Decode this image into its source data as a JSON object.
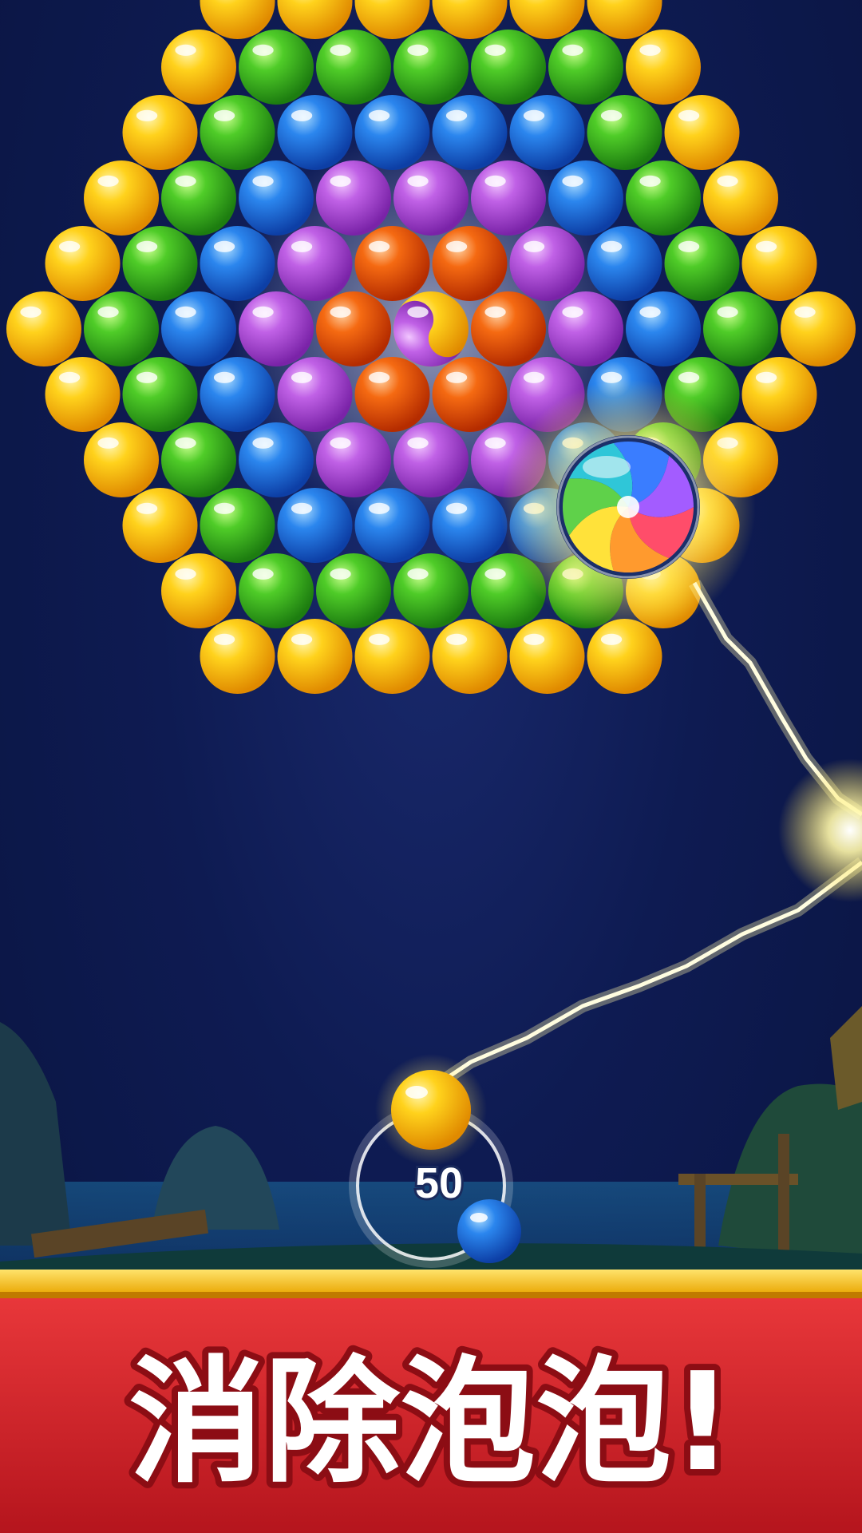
{
  "banner": {
    "text": "消除泡泡!"
  },
  "shooter": {
    "shots_left": "50",
    "current_ball_color": "yellow",
    "next_ball_color": "blue"
  },
  "special_bubble": {
    "type": "rainbow-swirl-bubble"
  },
  "center_bubble": {
    "type": "yin-yang-bubble",
    "colors": [
      "purple",
      "yellow"
    ]
  },
  "colors": {
    "yellow": "#f2b705",
    "green": "#35b31f",
    "blue": "#1f6ee0",
    "purple": "#b04dd6",
    "orange": "#f05a0a",
    "background": "#0e1b52",
    "banner_red": "#d8232a",
    "banner_gold": "#f7c21a"
  },
  "board": {
    "rows": [
      [
        "yellow",
        "yellow",
        "yellow",
        "yellow",
        "yellow",
        "yellow"
      ],
      [
        "yellow",
        "green",
        "green",
        "green",
        "green",
        "green",
        "yellow"
      ],
      [
        "yellow",
        "green",
        "blue",
        "blue",
        "blue",
        "blue",
        "green",
        "yellow"
      ],
      [
        "yellow",
        "green",
        "blue",
        "purple",
        "purple",
        "purple",
        "blue",
        "green",
        "yellow"
      ],
      [
        "yellow",
        "green",
        "blue",
        "purple",
        "orange",
        "orange",
        "purple",
        "blue",
        "green",
        "yellow"
      ],
      [
        "yellow",
        "green",
        "blue",
        "purple",
        "orange",
        "yinyang",
        "orange",
        "purple",
        "blue",
        "green",
        "yellow"
      ],
      [
        "yellow",
        "green",
        "blue",
        "purple",
        "orange",
        "orange",
        "purple",
        "blue",
        "green",
        "yellow"
      ],
      [
        "yellow",
        "green",
        "blue",
        "purple",
        "purple",
        "purple",
        "blue",
        "green",
        "yellow"
      ],
      [
        "yellow",
        "green",
        "blue",
        "blue",
        "blue",
        "blue",
        "green",
        "yellow"
      ],
      [
        "yellow",
        "green",
        "green",
        "green",
        "green",
        "green",
        "yellow"
      ],
      [
        "yellow",
        "yellow",
        "yellow",
        "yellow",
        "yellow",
        "yellow"
      ]
    ]
  }
}
